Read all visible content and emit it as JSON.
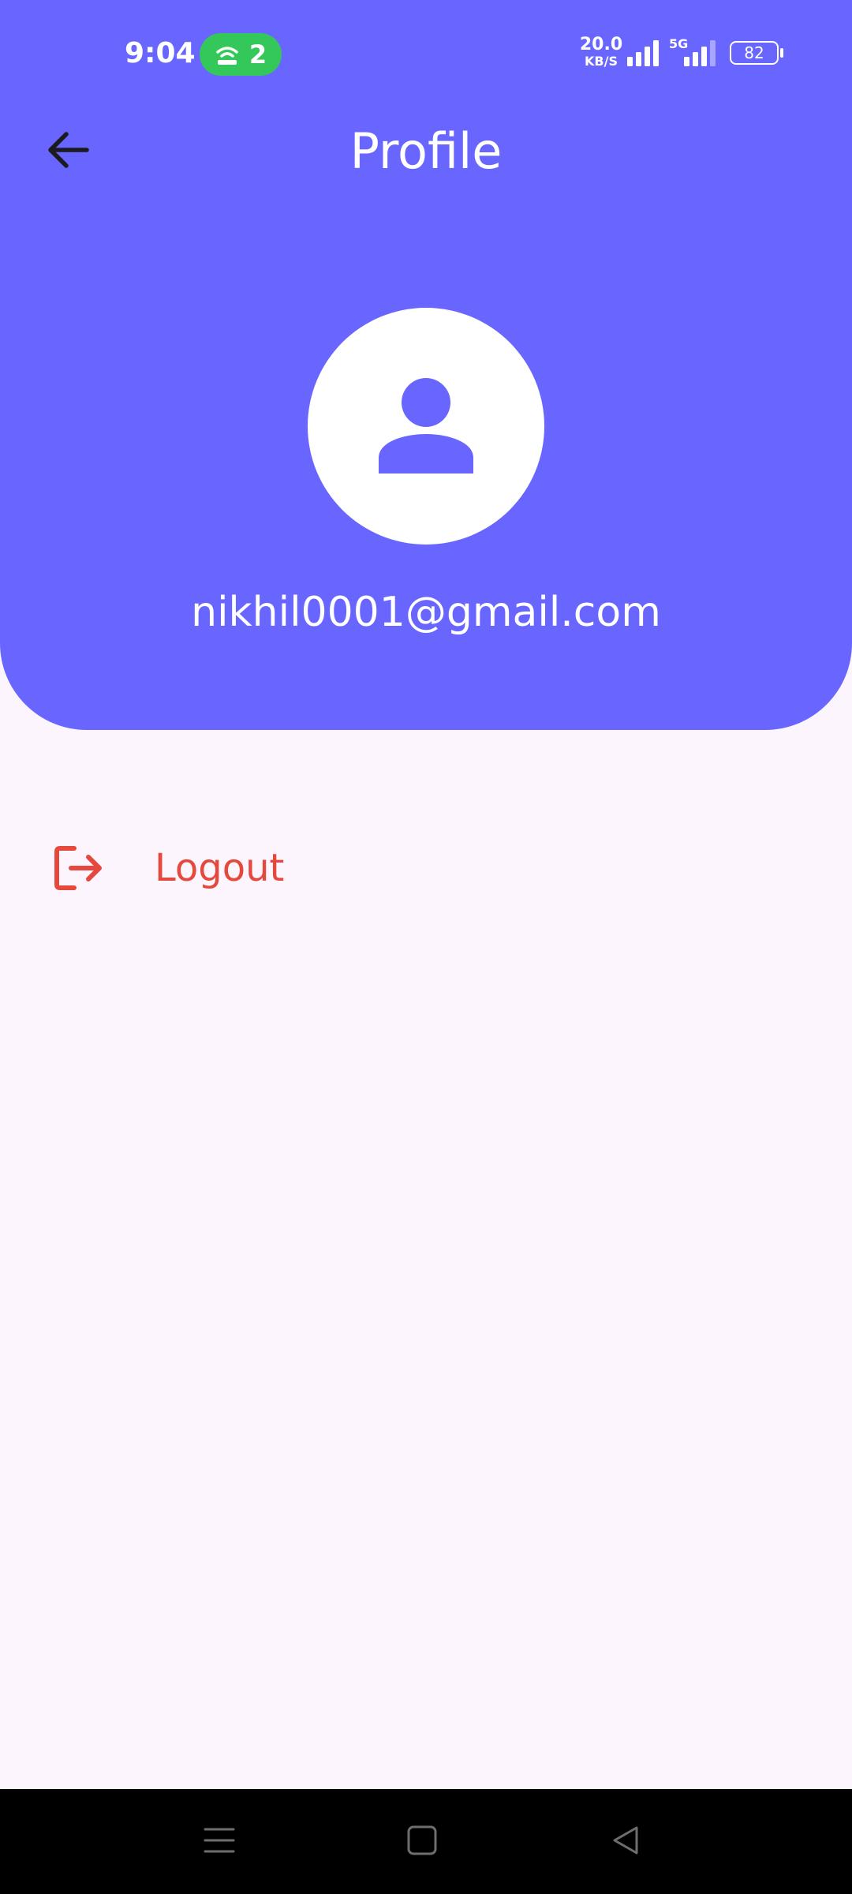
{
  "status_bar": {
    "time": "9:04",
    "hotspot_count": "2",
    "net_speed_value": "20.0",
    "net_speed_unit": "KB/S",
    "network_type": "5G",
    "battery": "82",
    "hotspot_color": "#34C759"
  },
  "app_bar": {
    "title": "Profile",
    "back_icon": "arrow-left-icon"
  },
  "profile": {
    "avatar_icon": "person-icon",
    "email": "nikhil0001@gmail.com"
  },
  "actions": {
    "logout_label": "Logout",
    "logout_icon": "logout-icon",
    "logout_color": "#E5493E"
  },
  "nav_bar": {
    "buttons": [
      "menu-icon",
      "home-icon",
      "back-triangle-icon"
    ]
  },
  "colors": {
    "primary": "#6966FF",
    "background": "#FCF5FD"
  }
}
